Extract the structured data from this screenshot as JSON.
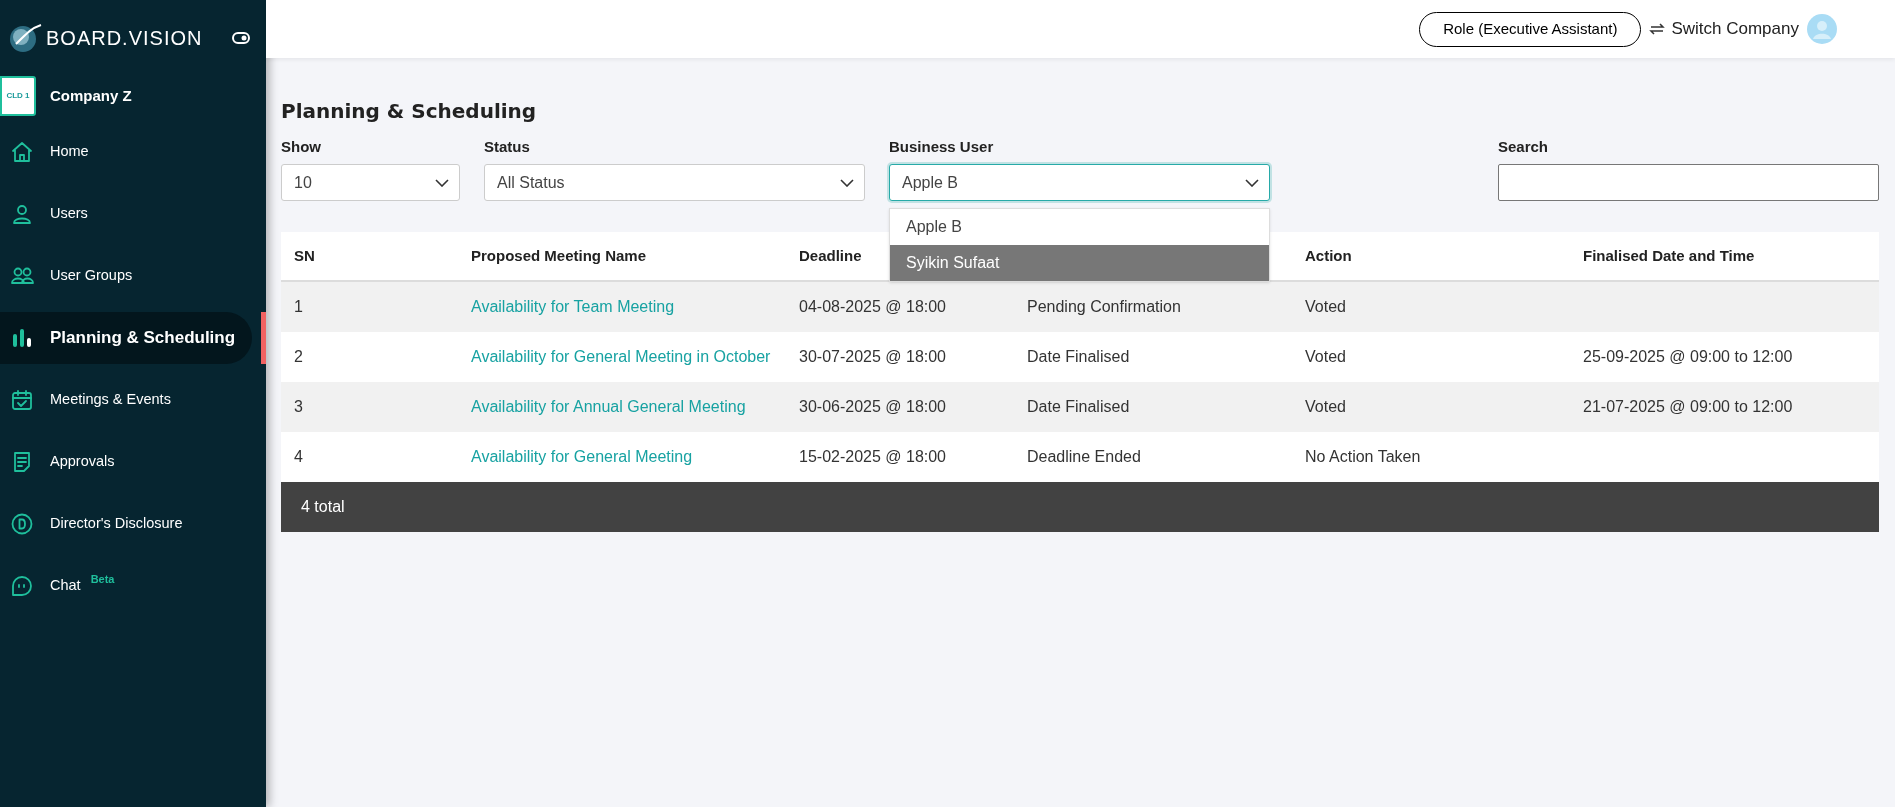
{
  "sidebar": {
    "brand": "BOARD.VISION",
    "company": {
      "logo_text": "CLD 1",
      "name": "Company Z"
    },
    "items": [
      {
        "label": "Home",
        "selected": false
      },
      {
        "label": "Users",
        "selected": false
      },
      {
        "label": "User Groups",
        "selected": false
      },
      {
        "label": "Planning & Scheduling",
        "selected": true
      },
      {
        "label": "Meetings & Events",
        "selected": false
      },
      {
        "label": "Approvals",
        "selected": false
      },
      {
        "label": "Director's Disclosure",
        "selected": false
      },
      {
        "label": "Chat",
        "selected": false,
        "badge": "Beta"
      }
    ]
  },
  "header": {
    "role_button": "Role (Executive Assistant)",
    "switch_company": "Switch Company"
  },
  "page": {
    "title": "Planning & Scheduling",
    "filters": {
      "show": {
        "label": "Show",
        "value": "10"
      },
      "status": {
        "label": "Status",
        "value": "All Status"
      },
      "business_user": {
        "label": "Business User",
        "value": "Apple B",
        "expanded": true,
        "options": [
          {
            "label": "Apple B",
            "highlighted": false
          },
          {
            "label": "Syikin Sufaat",
            "highlighted": true
          }
        ]
      },
      "search": {
        "label": "Search"
      }
    },
    "table": {
      "columns": [
        {
          "label": "SN"
        },
        {
          "label": "Proposed Meeting Name"
        },
        {
          "label": "Deadline"
        },
        {},
        {
          "label": "Action"
        },
        {
          "label": "Finalised Date and Time"
        }
      ],
      "rows": [
        {
          "sn": "1",
          "name": "Availability for Team Meeting",
          "deadline": "04-08-2025 @ 18:00",
          "status": "Pending Confirmation",
          "action": "Voted"
        },
        {
          "sn": "2",
          "name": "Availability for General Meeting in October",
          "deadline": "30-07-2025 @ 18:00",
          "status": "Date Finalised",
          "action": "Voted",
          "finalised": "25-09-2025 @ 09:00 to 12:00"
        },
        {
          "sn": "3",
          "name": "Availability for Annual General Meeting",
          "deadline": "30-06-2025 @ 18:00",
          "status": "Date Finalised",
          "action": "Voted",
          "finalised": "21-07-2025 @ 09:00 to 12:00"
        },
        {
          "sn": "4",
          "name": "Availability for General Meeting",
          "deadline": "15-02-2025 @ 18:00",
          "status": "Deadline Ended",
          "action": "No Action Taken"
        }
      ],
      "footer": "4 total"
    }
  }
}
